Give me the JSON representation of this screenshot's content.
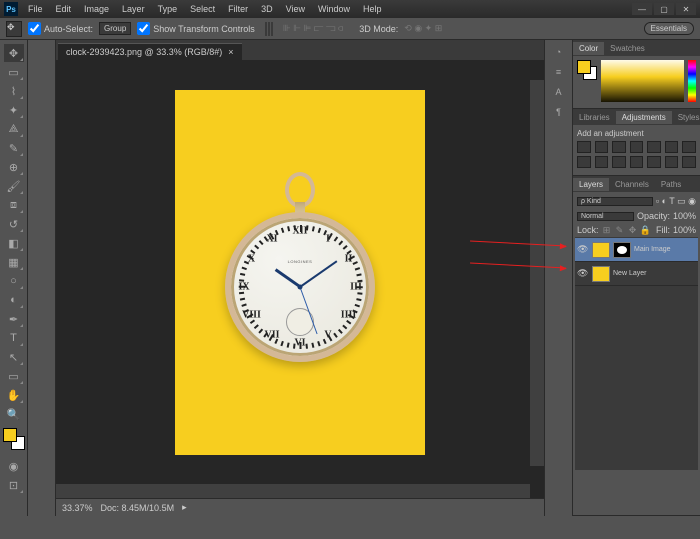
{
  "app": {
    "logo": "Ps"
  },
  "menu": [
    "File",
    "Edit",
    "Image",
    "Layer",
    "Type",
    "Select",
    "Filter",
    "3D",
    "View",
    "Window",
    "Help"
  ],
  "options": {
    "auto_select": "Auto-Select:",
    "auto_select_val": "Group",
    "show_transform": "Show Transform Controls",
    "mode_label": "3D Mode:",
    "essentials": "Essentials"
  },
  "doc": {
    "tab": "clock-2939423.png @ 33.3% (RGB/8#)",
    "close": "×"
  },
  "watch": {
    "brand": "LONGINES"
  },
  "status": {
    "zoom": "33.37%",
    "doc": "Doc: 8.45M/10.5M"
  },
  "panels": {
    "color": {
      "tabs": [
        "Color",
        "Swatches"
      ]
    },
    "adj": {
      "tabs": [
        "Libraries",
        "Adjustments",
        "Styles"
      ],
      "title": "Add an adjustment"
    },
    "layers": {
      "tabs": [
        "Layers",
        "Channels",
        "Paths"
      ],
      "kind": "ρ Kind",
      "blend": "Normal",
      "opacity_lbl": "Opacity:",
      "opacity": "100%",
      "lock_lbl": "Lock:",
      "fill_lbl": "Fill:",
      "fill": "100%",
      "items": [
        {
          "name": "Main Image",
          "has_mask": true
        },
        {
          "name": "New Layer",
          "has_mask": false
        }
      ]
    }
  },
  "numerals": [
    "XII",
    "I",
    "II",
    "III",
    "IIII",
    "V",
    "VI",
    "VII",
    "VIII",
    "IX",
    "X",
    "XI"
  ]
}
